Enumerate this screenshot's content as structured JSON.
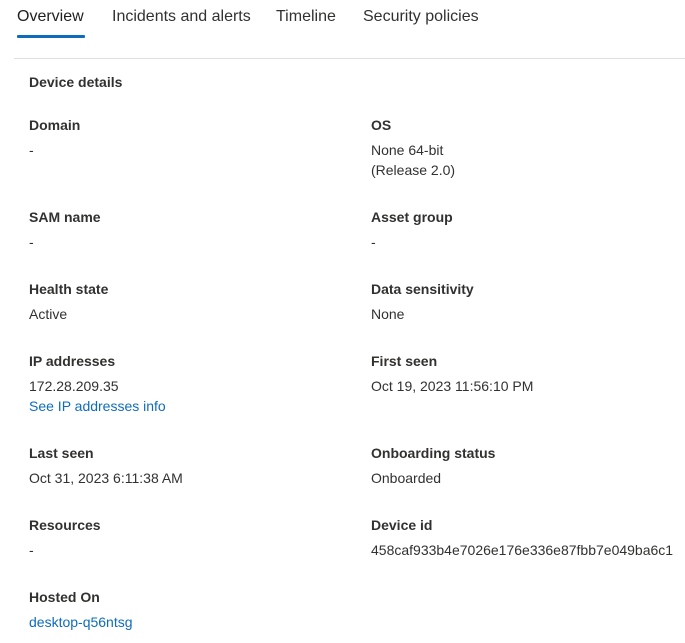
{
  "tabs": [
    {
      "label": "Overview",
      "active": true
    },
    {
      "label": "Incidents and alerts",
      "active": false
    },
    {
      "label": "Timeline",
      "active": false
    },
    {
      "label": "Security policies",
      "active": false
    }
  ],
  "section_title": "Device details",
  "fields": {
    "domain": {
      "label": "Domain",
      "value": "-"
    },
    "os": {
      "label": "OS",
      "value_line1": "None 64-bit",
      "value_line2": "(Release 2.0)"
    },
    "sam_name": {
      "label": "SAM name",
      "value": "-"
    },
    "asset_group": {
      "label": "Asset group",
      "value": "-"
    },
    "health_state": {
      "label": "Health state",
      "value": "Active"
    },
    "data_sensitivity": {
      "label": "Data sensitivity",
      "value": "None"
    },
    "ip_addresses": {
      "label": "IP addresses",
      "value": "172.28.209.35",
      "link": "See IP addresses info"
    },
    "first_seen": {
      "label": "First seen",
      "value": "Oct 19, 2023 11:56:10 PM"
    },
    "last_seen": {
      "label": "Last seen",
      "value": "Oct 31, 2023 6:11:38 AM"
    },
    "onboarding_status": {
      "label": "Onboarding status",
      "value": "Onboarded"
    },
    "resources": {
      "label": "Resources",
      "value": "-"
    },
    "device_id": {
      "label": "Device id",
      "value": "458caf933b4e7026e176e336e87fbb7e049ba6c1"
    },
    "hosted_on": {
      "label": "Hosted On",
      "value": "desktop-q56ntsg"
    }
  },
  "colors": {
    "accent": "#0f6cbd",
    "text": "#323130",
    "divider": "#e1dfdd"
  }
}
